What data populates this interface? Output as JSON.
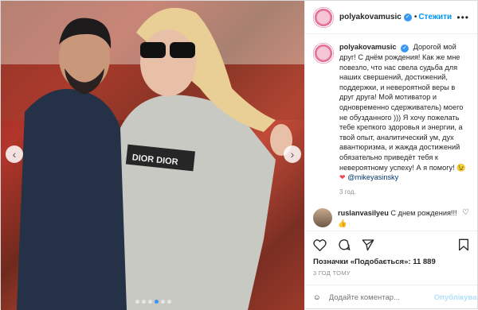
{
  "header": {
    "username": "polyakovamusic",
    "follow_label": "Стежити",
    "more_glyph": "•••"
  },
  "caption": {
    "username": "polyakovamusic",
    "text": "Дорогой мой друг! С днём рождения! Как же мне повезло, что нас свела судьба для наших свершений, достижений, поддержки, и невероятной веры в друг друга! Мой мотиватор и одновременно сдерживатель) моего не обузданного ))) Я хочу пожелать тебе крепкого здоровья и энергии, а твой опыт, аналитический ум, дух авантюризма, и жажда достижений обязательно приведёт тебя к невероятному успеху! А я помогу!",
    "emoji": "😉",
    "heart": "❤",
    "mention": "@mikeyasinsky",
    "time": "3 год."
  },
  "reply": {
    "username": "ruslanvasilyeu",
    "text": "С днем рождения!!!",
    "emoji": "👍"
  },
  "likes_text": "Позначки «Подобається»: 11 889",
  "ago_text": "3 ГОД ТОМУ",
  "comment_input": {
    "placeholder": "Додайте коментар...",
    "publish_label": "Опублікувати"
  },
  "photo": {
    "shirt_print": "DIOR DIOR"
  }
}
